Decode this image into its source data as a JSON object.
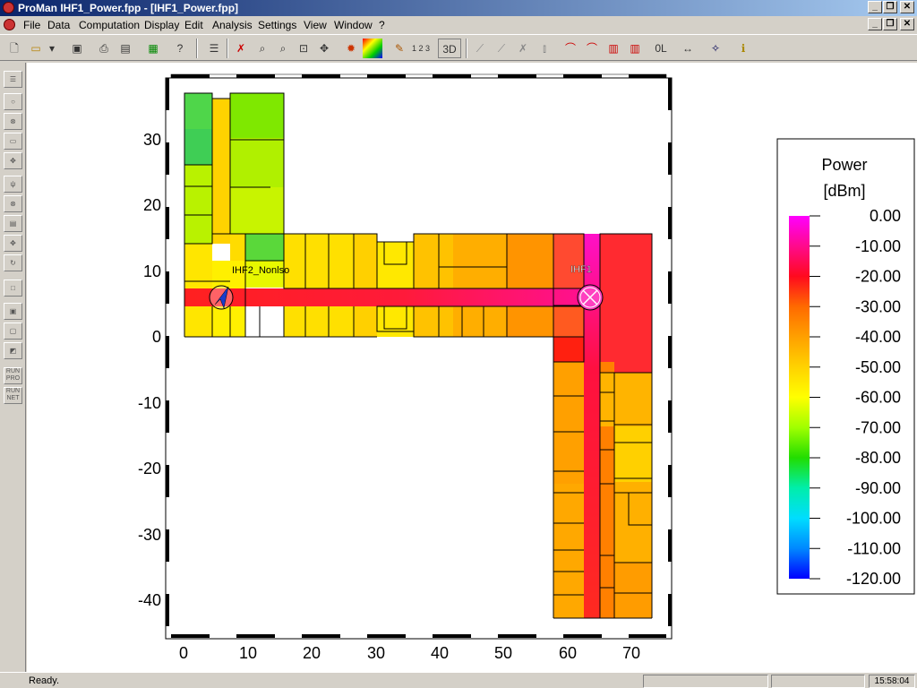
{
  "window": {
    "title": "ProMan IHF1_Power.fpp - [IHF1_Power.fpp]",
    "minimize_glyph": "_",
    "restore_glyph": "❐",
    "close_glyph": "✕"
  },
  "menu": [
    "File",
    "Data",
    "Computation",
    "Display",
    "Edit",
    "Analysis",
    "Settings",
    "View",
    "Window",
    "?"
  ],
  "toolbar": {
    "icons": [
      "new-file-icon",
      "open-folder-icon",
      "dropdown-arrow-icon",
      "save-icon",
      "print-icon",
      "print-preview-icon",
      "map-icon",
      "help-icon",
      "list-icon",
      "delete-icon",
      "zoom-out-icon",
      "zoom-in-icon",
      "zoom-fit-icon",
      "pan-icon",
      "settings-gear-icon",
      "color-palette-icon",
      "pencil-icon",
      "numbering-icon",
      "3d-view-icon",
      "curve-icon",
      "curve-edit-icon",
      "curve-delete-icon",
      "bar-chart-icon",
      "analysis-icon",
      "analysis-cursor-icon",
      "histogram-icon",
      "histogram-red-icon",
      "zero-level-icon",
      "measure-distance-icon",
      "tools-icon",
      "info-icon"
    ],
    "numbering_label": "1 2 3",
    "view3d_label": "3D",
    "zero_level_label": "0L"
  },
  "left_toolbar": {
    "icons": [
      "tree-icon",
      "circle-icon",
      "circle-cross-icon",
      "layers-icon",
      "target-icon",
      "antenna-icon",
      "antenna-cross-icon",
      "properties-icon",
      "move-icon",
      "rotate-icon",
      "square-icon",
      "square-inner-icon",
      "square-double-icon",
      "square-diagonal-icon",
      "run-pro-icon",
      "run-net-icon"
    ],
    "run_pro_label": "RUN PRO",
    "run_net_label": "RUN NET"
  },
  "plot": {
    "x_ticks": [
      0,
      10,
      20,
      30,
      40,
      50,
      60,
      70
    ],
    "y_ticks": [
      30,
      20,
      10,
      0,
      -10,
      -20,
      -30,
      -40
    ],
    "x_range": [
      -3,
      75.5
    ],
    "y_range": [
      -45.8,
      39.2
    ],
    "transmitters": [
      {
        "label": "IHF2_Nonlso",
        "x": 6,
        "y": 6,
        "kind": "directional"
      },
      {
        "label": "IHF1",
        "x": 63,
        "y": 6,
        "kind": "omni"
      }
    ]
  },
  "legend": {
    "title": "Power",
    "unit": "[dBm]",
    "labels": [
      "0.00",
      "-10.00",
      "-20.00",
      "-30.00",
      "-40.00",
      "-50.00",
      "-60.00",
      "-70.00",
      "-80.00",
      "-90.00",
      "-100.00",
      "-110.00",
      "-120.00"
    ],
    "colors": [
      "#ff00ff",
      "#ff0a8c",
      "#ff0a1e",
      "#ff6a00",
      "#ffa000",
      "#ffd200",
      "#ffff00",
      "#a0ff00",
      "#22dd00",
      "#00eeaa",
      "#00ddff",
      "#0088ff",
      "#0000ff"
    ]
  },
  "status": {
    "text": "Ready.",
    "clock": "15:58:04"
  }
}
